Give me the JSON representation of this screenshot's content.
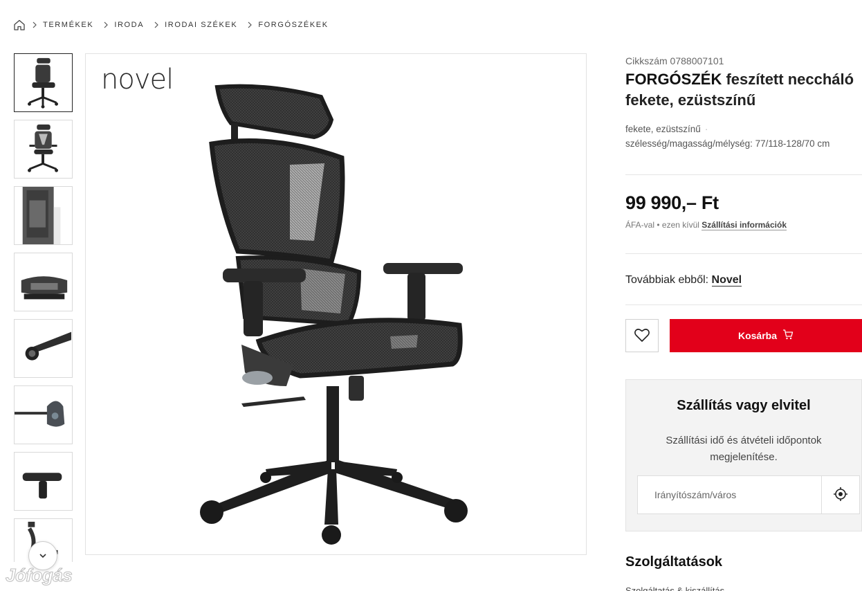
{
  "breadcrumb": {
    "home_icon": "home-icon",
    "items": [
      "TERMÉKEK",
      "IRODA",
      "IRODAI SZÉKEK",
      "FORGÓSZÉKEK"
    ]
  },
  "gallery": {
    "brand_logo": "novel",
    "thumbnail_count": 8,
    "active_index": 0,
    "scroll_icon": "chevron-down-icon"
  },
  "watermark": "Jófogás",
  "product": {
    "sku_label": "Cikkszám 0788007101",
    "title_bold": "FORGÓSZÉK",
    "title_rest": " feszített neccháló fekete, ezüstszínű",
    "color": "fekete, ezüstszínű",
    "dimensions": "szélesség/magasság/mélység: 77/118-128/70 cm"
  },
  "price": {
    "value": "99 990,– Ft",
    "vat": "ÁFA-val",
    "shipping_excluded": "ezen kívül",
    "shipping_link": "Szállítási információk"
  },
  "more_from": {
    "label": "Továbbiak ebből: ",
    "brand": "Novel"
  },
  "actions": {
    "wishlist_icon": "heart-icon",
    "cart_label": "Kosárba",
    "cart_icon": "cart-icon"
  },
  "delivery": {
    "title": "Szállítás vagy elvitel",
    "text": "Szállítási idő és átvételi időpontok megjelenítése.",
    "input_placeholder": "Irányítószám/város",
    "locate_icon": "location-target-icon"
  },
  "services": {
    "title": "Szolgáltatások",
    "first_item": "Szolgáltatás & kiszállítás"
  },
  "colors": {
    "accent": "#e2001a",
    "panel": "#f3f3f3"
  }
}
